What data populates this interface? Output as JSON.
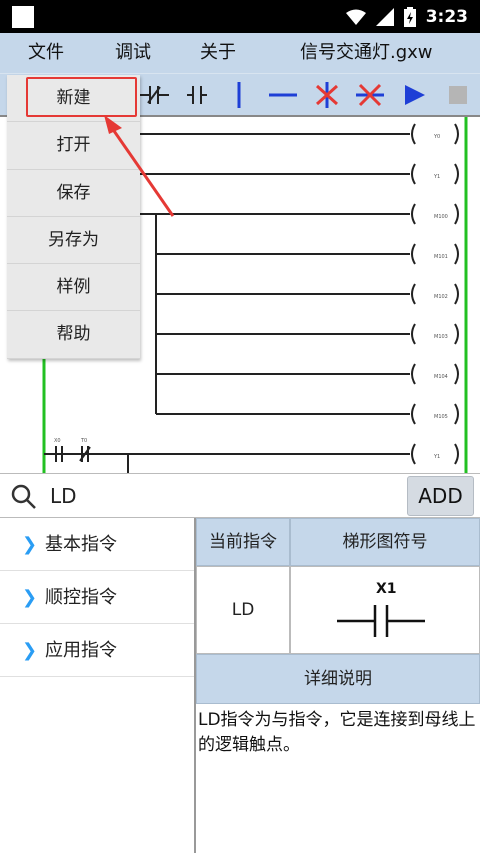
{
  "status": {
    "time": "3:23"
  },
  "menu": {
    "file": "文件",
    "debug": "调试",
    "about": "关于",
    "filename": "信号交通灯.gxw"
  },
  "dropdown": {
    "items": [
      "新建",
      "打开",
      "保存",
      "另存为",
      "样例",
      "帮助"
    ]
  },
  "ladder": {
    "coil_labels": [
      "Y0",
      "Y1",
      "M100",
      "M101",
      "M102",
      "M103",
      "M104",
      "M105",
      "Y1"
    ],
    "contact_labels": [
      "X0",
      "T0"
    ]
  },
  "search": {
    "query": "LD",
    "add_label": "ADD"
  },
  "categories": [
    "基本指令",
    "顺控指令",
    "应用指令"
  ],
  "detail": {
    "current_header": "当前指令",
    "symbol_header": "梯形图符号",
    "current_value": "LD",
    "symbol_label": "X1",
    "desc_header": "详细说明",
    "description": "LD指令为与指令，它是连接到母线上的逻辑触点。"
  },
  "colors": {
    "accent": "#2a9df4",
    "toolbar_bg": "#c5d7ea",
    "highlight": "#e53935",
    "bus_green": "#22c022"
  }
}
